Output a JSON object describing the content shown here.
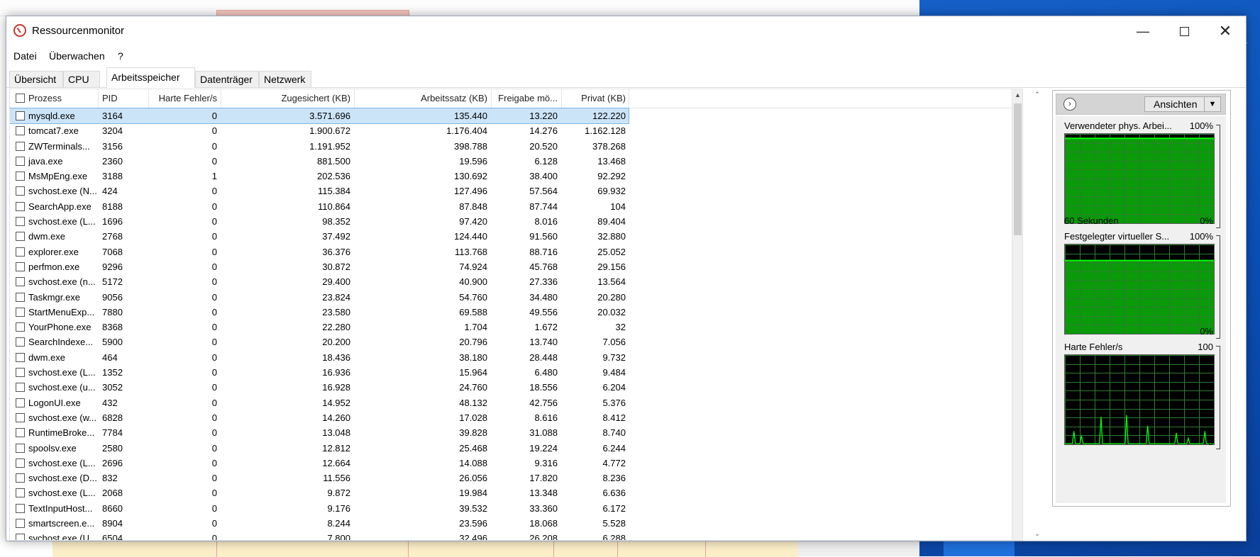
{
  "window": {
    "title": "Ressourcenmonitor"
  },
  "menu": [
    "Datei",
    "Überwachen",
    "?"
  ],
  "tabs": [
    "Übersicht",
    "CPU",
    "Arbeitsspeicher",
    "Datenträger",
    "Netzwerk"
  ],
  "active_tab": "Arbeitsspeicher",
  "table": {
    "columns": [
      "Prozess",
      "PID",
      "Harte Fehler/s",
      "Zugesichert (KB)",
      "Arbeitssatz (KB)",
      "Freigabe mö...",
      "Privat (KB)"
    ],
    "rows": [
      [
        "mysqld.exe",
        "3164",
        "0",
        "3.571.696",
        "135.440",
        "13.220",
        "122.220"
      ],
      [
        "tomcat7.exe",
        "3204",
        "0",
        "1.900.672",
        "1.176.404",
        "14.276",
        "1.162.128"
      ],
      [
        "ZWTerminals...",
        "3156",
        "0",
        "1.191.952",
        "398.788",
        "20.520",
        "378.268"
      ],
      [
        "java.exe",
        "2360",
        "0",
        "881.500",
        "19.596",
        "6.128",
        "13.468"
      ],
      [
        "MsMpEng.exe",
        "3188",
        "1",
        "202.536",
        "130.692",
        "38.400",
        "92.292"
      ],
      [
        "svchost.exe (N...",
        "424",
        "0",
        "115.384",
        "127.496",
        "57.564",
        "69.932"
      ],
      [
        "SearchApp.exe",
        "8188",
        "0",
        "110.864",
        "87.848",
        "87.744",
        "104"
      ],
      [
        "svchost.exe (L...",
        "1696",
        "0",
        "98.352",
        "97.420",
        "8.016",
        "89.404"
      ],
      [
        "dwm.exe",
        "2768",
        "0",
        "37.492",
        "124.440",
        "91.560",
        "32.880"
      ],
      [
        "explorer.exe",
        "7068",
        "0",
        "36.376",
        "113.768",
        "88.716",
        "25.052"
      ],
      [
        "perfmon.exe",
        "9296",
        "0",
        "30.872",
        "74.924",
        "45.768",
        "29.156"
      ],
      [
        "svchost.exe (n...",
        "5172",
        "0",
        "29.400",
        "40.900",
        "27.336",
        "13.564"
      ],
      [
        "Taskmgr.exe",
        "9056",
        "0",
        "23.824",
        "54.760",
        "34.480",
        "20.280"
      ],
      [
        "StartMenuExp...",
        "7880",
        "0",
        "23.580",
        "69.588",
        "49.556",
        "20.032"
      ],
      [
        "YourPhone.exe",
        "8368",
        "0",
        "22.280",
        "1.704",
        "1.672",
        "32"
      ],
      [
        "SearchIndexe...",
        "5900",
        "0",
        "20.200",
        "20.796",
        "13.740",
        "7.056"
      ],
      [
        "dwm.exe",
        "464",
        "0",
        "18.436",
        "38.180",
        "28.448",
        "9.732"
      ],
      [
        "svchost.exe (L...",
        "1352",
        "0",
        "16.936",
        "15.964",
        "6.480",
        "9.484"
      ],
      [
        "svchost.exe (u...",
        "3052",
        "0",
        "16.928",
        "24.760",
        "18.556",
        "6.204"
      ],
      [
        "LogonUI.exe",
        "432",
        "0",
        "14.952",
        "48.132",
        "42.756",
        "5.376"
      ],
      [
        "svchost.exe (w...",
        "6828",
        "0",
        "14.260",
        "17.028",
        "8.616",
        "8.412"
      ],
      [
        "RuntimeBroke...",
        "7784",
        "0",
        "13.048",
        "39.828",
        "31.088",
        "8.740"
      ],
      [
        "spoolsv.exe",
        "2580",
        "0",
        "12.812",
        "25.468",
        "19.224",
        "6.244"
      ],
      [
        "svchost.exe (L...",
        "2696",
        "0",
        "12.664",
        "14.088",
        "9.316",
        "4.772"
      ],
      [
        "svchost.exe (D...",
        "832",
        "0",
        "11.556",
        "26.056",
        "17.820",
        "8.236"
      ],
      [
        "svchost.exe (L...",
        "2068",
        "0",
        "9.872",
        "19.984",
        "13.348",
        "6.636"
      ],
      [
        "TextInputHost...",
        "8660",
        "0",
        "9.176",
        "39.532",
        "33.360",
        "6.172"
      ],
      [
        "smartscreen.e...",
        "8904",
        "0",
        "8.244",
        "23.596",
        "18.068",
        "5.528"
      ],
      [
        "svchost.exe (U...",
        "6504",
        "0",
        "7.800",
        "32.496",
        "26.208",
        "6.288"
      ]
    ]
  },
  "panel": {
    "views_label": "Ansichten",
    "graphs": [
      {
        "title": "Verwendeter phys. Arbei...",
        "max": "100%",
        "min": "0%",
        "xlabel": "60 Sekunden",
        "level": 0.95,
        "color": "#00c800"
      },
      {
        "title": "Festgelegter virtueller S...",
        "max": "100%",
        "min": "0%",
        "xlabel": "",
        "level": 0.82,
        "color": "#00c800"
      },
      {
        "title": "Harte Fehler/s",
        "max": "100",
        "min": "0",
        "xlabel": "",
        "spikes": [
          0,
          0,
          0,
          0,
          0,
          0,
          14,
          0,
          0,
          0,
          0,
          9,
          0,
          0,
          0,
          0,
          0,
          0,
          0,
          0,
          0,
          0,
          0,
          0,
          30,
          0,
          0,
          0,
          0,
          0,
          0,
          0,
          0,
          0,
          0,
          0,
          0,
          0,
          0,
          0,
          0,
          32,
          0,
          0,
          0,
          0,
          0,
          0,
          0,
          0,
          0,
          0,
          0,
          0,
          0,
          20,
          0,
          0,
          0,
          0,
          0,
          0,
          0,
          0,
          0,
          0,
          0,
          0,
          0,
          0,
          0,
          0,
          0,
          0,
          12,
          0,
          0,
          0,
          0,
          0,
          0,
          0,
          6,
          0,
          0,
          0,
          0,
          0,
          0,
          0,
          0,
          0,
          0,
          14,
          0,
          0,
          0,
          0,
          0,
          0
        ],
        "color": "#00c800"
      }
    ]
  }
}
